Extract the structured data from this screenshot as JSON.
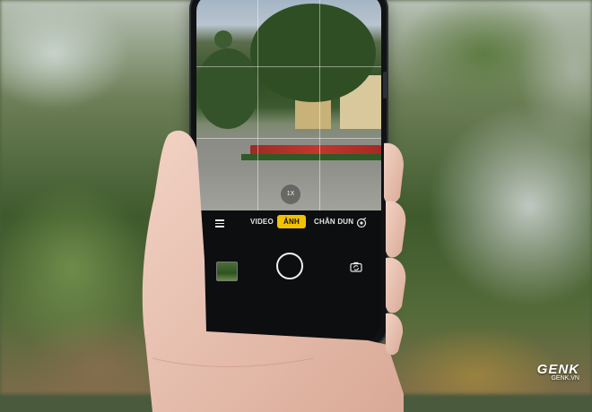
{
  "camera": {
    "zoom_label": "1X",
    "modes": {
      "video": "VIDEO",
      "photo": "ẢNH",
      "portrait": "CHÂN DUN"
    },
    "active_mode": "photo",
    "icons": {
      "menu": "hamburger-menu-icon",
      "settings": "camera-settings-icon",
      "shutter": "shutter-button",
      "flip": "flip-camera-icon",
      "gallery": "gallery-thumbnail"
    },
    "accent_color": "#f2c100"
  },
  "watermark": {
    "brand": "GENK",
    "site": "GENK.VN"
  }
}
